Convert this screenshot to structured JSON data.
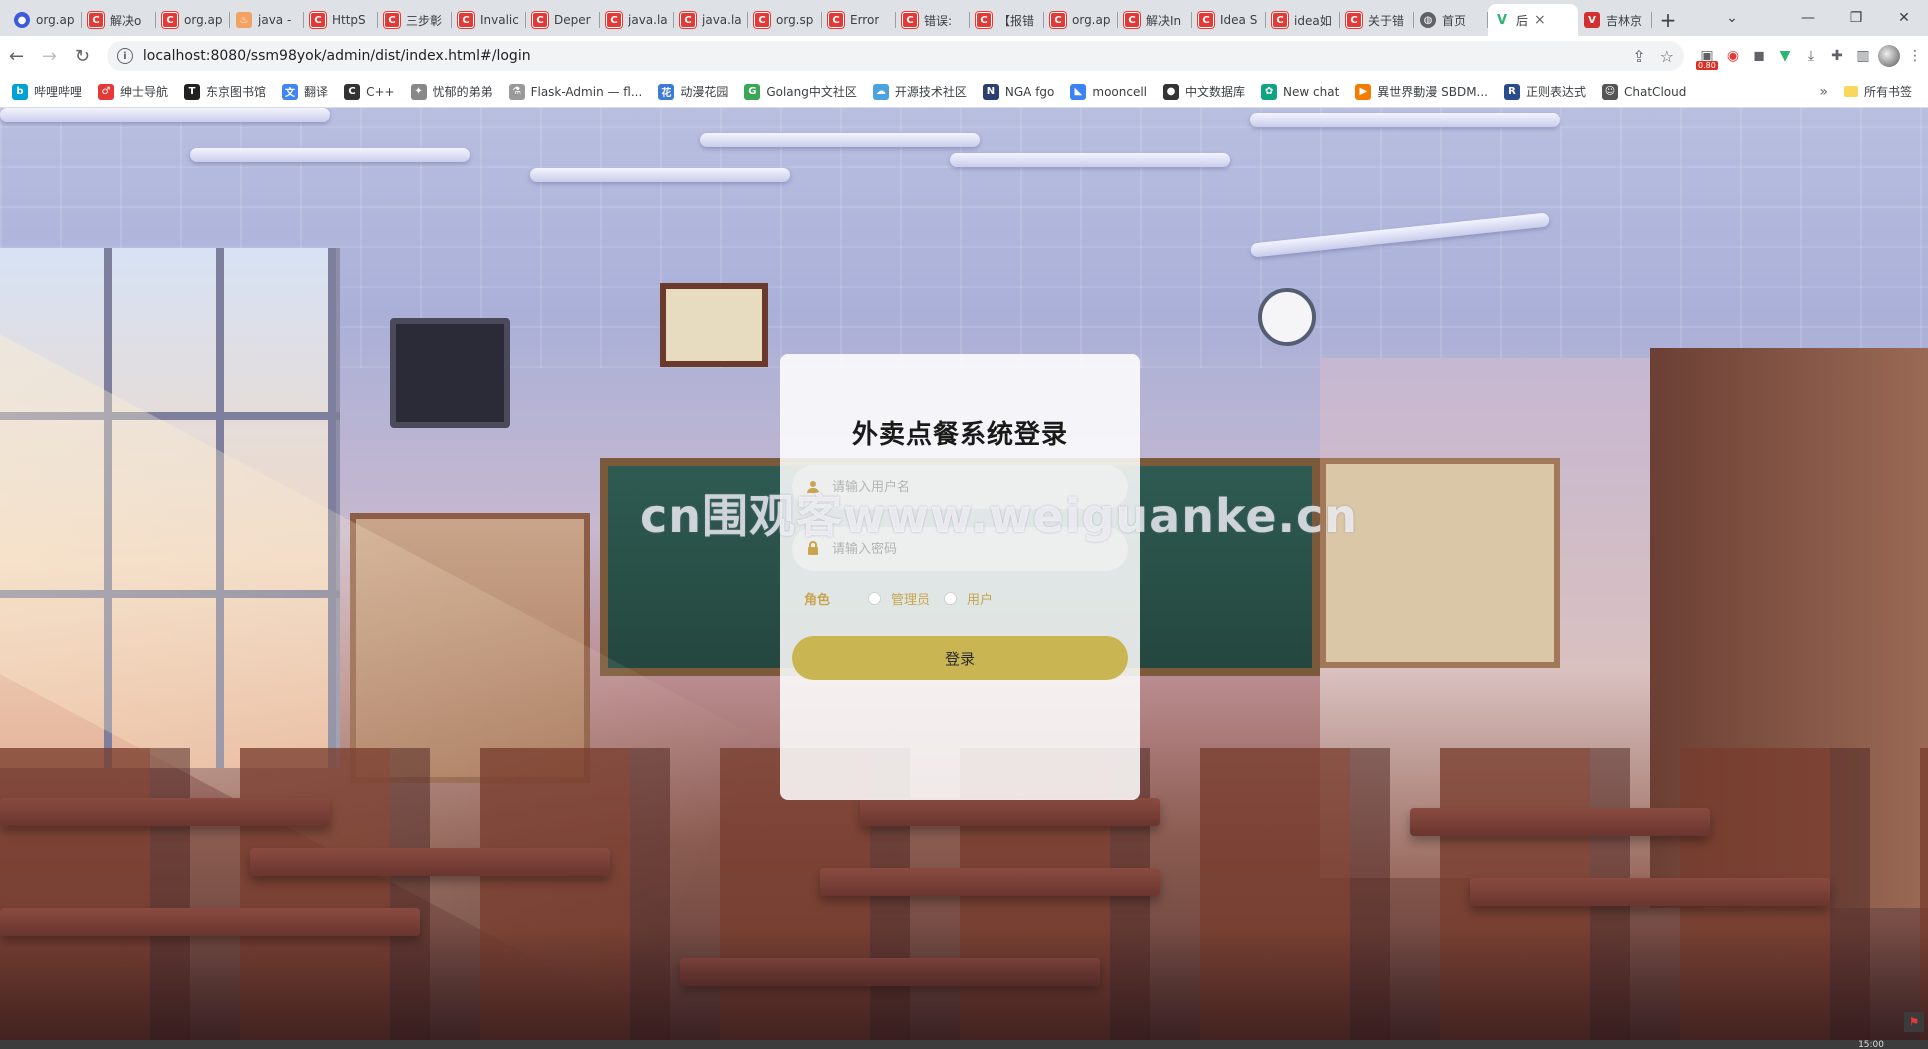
{
  "tabs": [
    {
      "label": "org.ap",
      "icon": "github-icon",
      "fav": "fav-blue",
      "glyph": "●"
    },
    {
      "label": "解决o",
      "icon": "csdn-icon",
      "fav": "fav-c",
      "glyph": "C"
    },
    {
      "label": "org.ap",
      "icon": "csdn-icon",
      "fav": "fav-c",
      "glyph": "C"
    },
    {
      "label": "java -",
      "icon": "java-icon",
      "fav": "fav-java",
      "glyph": "♨"
    },
    {
      "label": "HttpS",
      "icon": "csdn-icon",
      "fav": "fav-c",
      "glyph": "C"
    },
    {
      "label": "三步彰",
      "icon": "csdn-icon",
      "fav": "fav-c",
      "glyph": "C"
    },
    {
      "label": "Invalic",
      "icon": "csdn-icon",
      "fav": "fav-c",
      "glyph": "C"
    },
    {
      "label": "Deper",
      "icon": "csdn-icon",
      "fav": "fav-c",
      "glyph": "C"
    },
    {
      "label": "java.la",
      "icon": "csdn-icon",
      "fav": "fav-c",
      "glyph": "C"
    },
    {
      "label": "java.la",
      "icon": "csdn-icon",
      "fav": "fav-c",
      "glyph": "C"
    },
    {
      "label": "org.sp",
      "icon": "csdn-icon",
      "fav": "fav-c",
      "glyph": "C"
    },
    {
      "label": "Error",
      "icon": "csdn-icon",
      "fav": "fav-c",
      "glyph": "C"
    },
    {
      "label": "错误:",
      "icon": "csdn-icon",
      "fav": "fav-c",
      "glyph": "C"
    },
    {
      "label": "【报错",
      "icon": "csdn-icon",
      "fav": "fav-c",
      "glyph": "C"
    },
    {
      "label": "org.ap",
      "icon": "csdn-icon",
      "fav": "fav-c",
      "glyph": "C"
    },
    {
      "label": "解决In",
      "icon": "csdn-icon",
      "fav": "fav-c",
      "glyph": "C"
    },
    {
      "label": "Idea S",
      "icon": "csdn-icon",
      "fav": "fav-c",
      "glyph": "C"
    },
    {
      "label": "idea如",
      "icon": "csdn-icon",
      "fav": "fav-c",
      "glyph": "C"
    },
    {
      "label": "关于错",
      "icon": "csdn-icon",
      "fav": "fav-c",
      "glyph": "C"
    },
    {
      "label": "首页",
      "icon": "globe-icon",
      "fav": "fav-globe",
      "glyph": "◍"
    }
  ],
  "active_tab": {
    "label": "后",
    "icon": "vue-icon",
    "glyph": "V"
  },
  "last_tab": {
    "label": "吉林京",
    "icon": "v-red-icon",
    "glyph": "V"
  },
  "address": {
    "url": "localhost:8080/ssm98yok/admin/dist/index.html#/login"
  },
  "extensions": {
    "badge": "0.80"
  },
  "bookmarks": [
    {
      "label": "哔哩哔哩",
      "icon": "bilibili-icon",
      "color": "#00a1d6",
      "glyph": "b"
    },
    {
      "label": "绅士导航",
      "icon": "mars-icon",
      "color": "#e53935",
      "glyph": "♂"
    },
    {
      "label": "东京图书馆",
      "icon": "t-icon",
      "color": "#222222",
      "glyph": "T"
    },
    {
      "label": "翻译",
      "icon": "translate-icon",
      "color": "#4285f4",
      "glyph": "文"
    },
    {
      "label": "C++",
      "icon": "cpp-icon",
      "color": "#333333",
      "glyph": "C"
    },
    {
      "label": "忧郁的弟弟",
      "icon": "spark-icon",
      "color": "#888888",
      "glyph": "✦"
    },
    {
      "label": "Flask-Admin — fl...",
      "icon": "flask-icon",
      "color": "#999999",
      "glyph": "⚗"
    },
    {
      "label": "动漫花园",
      "icon": "anime-icon",
      "color": "#3d7bd9",
      "glyph": "花"
    },
    {
      "label": "Golang中文社区",
      "icon": "golang-icon",
      "color": "#3aa757",
      "glyph": "G"
    },
    {
      "label": "开源技术社区",
      "icon": "cloud-icon",
      "color": "#4aa3df",
      "glyph": "☁"
    },
    {
      "label": "NGA fgo",
      "icon": "nga-icon",
      "color": "#2c3e70",
      "glyph": "N"
    },
    {
      "label": "mooncell",
      "icon": "mooncell-icon",
      "color": "#3b82f6",
      "glyph": "◣"
    },
    {
      "label": "中文数据库",
      "icon": "github-icon",
      "color": "#333333",
      "glyph": "●"
    },
    {
      "label": "New chat",
      "icon": "openai-icon",
      "color": "#10a37f",
      "glyph": "✿"
    },
    {
      "label": "異世界動漫 SBDM...",
      "icon": "play-icon",
      "color": "#f57c00",
      "glyph": "▶"
    },
    {
      "label": "正则表达式",
      "icon": "r-icon",
      "color": "#2b4c8c",
      "glyph": "R"
    },
    {
      "label": "ChatCloud",
      "icon": "chatcloud-icon",
      "color": "#555555",
      "glyph": "☺"
    }
  ],
  "bookmarks_more": "»",
  "bookmarks_all": "所有书签",
  "login": {
    "title": "外卖点餐系统登录",
    "username_placeholder": "请输入用户名",
    "password_placeholder": "请输入密码",
    "role_label": "角色",
    "roles": [
      "管理员",
      "用户"
    ],
    "submit": "登录"
  },
  "watermark": "cn围观客www.weiguanke.cn",
  "taskbar_time": "15:00",
  "colors": {
    "accent": "#c9b652",
    "label_gold": "#c9a54f",
    "csdn": "#e53935"
  }
}
